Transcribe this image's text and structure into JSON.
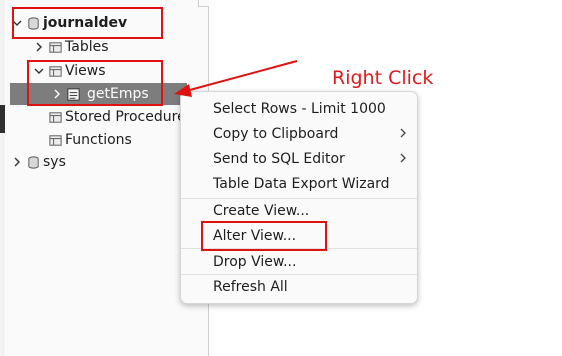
{
  "tree": {
    "schema": {
      "label": "journaldev",
      "icon": "database-icon"
    },
    "items": [
      {
        "label": "Tables",
        "icon": "table-folder-icon"
      },
      {
        "label": "Views",
        "icon": "view-folder-icon"
      },
      {
        "label": "getEmps",
        "icon": "view-icon"
      },
      {
        "label": "Stored Procedures",
        "icon": "procedure-folder-icon"
      },
      {
        "label": "Functions",
        "icon": "function-folder-icon"
      }
    ],
    "other_schema": {
      "label": "sys",
      "icon": "database-icon"
    }
  },
  "context_menu": {
    "items": [
      {
        "label": "Select Rows - Limit 1000"
      },
      {
        "label": "Copy to Clipboard",
        "submenu": true
      },
      {
        "label": "Send to SQL Editor",
        "submenu": true
      },
      {
        "label": "Table Data Export Wizard"
      },
      {
        "label": "Create View..."
      },
      {
        "label": "Alter View..."
      },
      {
        "label": "Drop View..."
      },
      {
        "label": "Refresh All"
      }
    ]
  },
  "annotation": {
    "label": "Right Click",
    "color": "#e01a1a"
  },
  "colors": {
    "selection": "#7d7d7d",
    "highlight_box": "#e01111"
  }
}
